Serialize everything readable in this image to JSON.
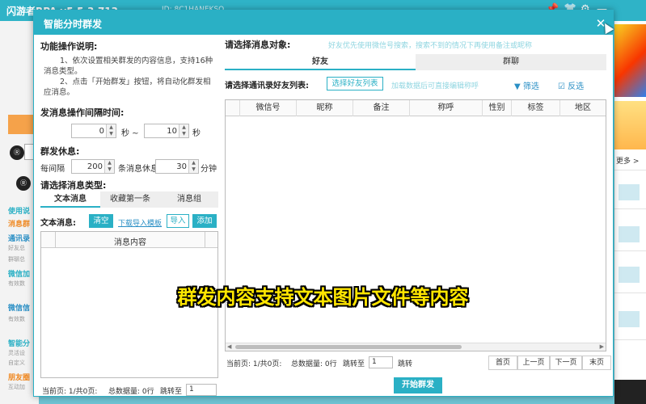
{
  "app": {
    "title": "闪游者RPA  v5.5.3.713",
    "title_extra": "ID: 8C1HANEKSO",
    "sidebar": [
      {
        "label": "使用说",
        "color": "#2ab0c5"
      },
      {
        "label": "消息群",
        "color": "#f08a24"
      },
      {
        "label": "通讯录",
        "color": "#2a8fc5"
      },
      {
        "label": "好友总",
        "color": "#999999",
        "sub": true
      },
      {
        "label": "群聊总",
        "color": "#999999",
        "sub": true
      },
      {
        "label": "微信加",
        "color": "#2ab0c5"
      },
      {
        "label": "有效数",
        "color": "#999999",
        "sub": true
      },
      {
        "label": "微信信",
        "color": "#2a8fc5"
      },
      {
        "label": "有效数",
        "color": "#999999",
        "sub": true
      },
      {
        "label": "智能分",
        "color": "#2ab0c5"
      },
      {
        "label": "灵活设",
        "color": "#999999",
        "sub": true
      },
      {
        "label": "自定义",
        "color": "#999999",
        "sub": true
      },
      {
        "label": "朋友圈",
        "color": "#f08a24"
      },
      {
        "label": "互动加",
        "color": "#999999",
        "sub": true
      }
    ],
    "circle_icons": [
      "Ⓡ",
      "Ⓡ"
    ],
    "right_more": "更多 >"
  },
  "dialog": {
    "title": "智能分时群发",
    "close": "✕",
    "left": {
      "desc_title": "功能操作说明:",
      "desc_1": "1、依次设置相关群发的内容信息，支持16种消息类型。",
      "desc_2": "2、点击「开始群发」按钮，将自动化群发相应消息。",
      "interval_title": "发消息操作间隔时间:",
      "interval_min": "0",
      "interval_sep": "秒 ~",
      "interval_max": "10",
      "interval_unit": "秒",
      "rest_title": "群发休息:",
      "rest_prefix": "每间隔",
      "rest_count": "200",
      "rest_mid": "条消息休息",
      "rest_minutes": "30",
      "rest_unit": "分钟",
      "type_title": "请选择消息类型:",
      "tabs": [
        "文本消息",
        "收藏第一条",
        "消息组"
      ],
      "text_label": "文本消息:",
      "btn_clear": "清空",
      "link_template": "下载导入模板",
      "btn_import": "导入",
      "btn_add": "添加",
      "table_header": "消息内容",
      "pager": {
        "current": "当前页: 1/共0页:",
        "total": "总数据量: 0行",
        "jump": "跳转至",
        "page": "1"
      }
    },
    "right": {
      "target_title": "请选择消息对象:",
      "target_hint": "好友优先使用微信号搜索，搜索不到的情况下再使用备注或昵称",
      "tabs": [
        "好友",
        "群聊"
      ],
      "select_title": "请选择通讯录好友列表:",
      "btn_select": "选择好友列表",
      "select_hint": "加载数据后可直接编辑称呼",
      "filter": "筛选",
      "invert": "反选",
      "columns": [
        "微信号",
        "昵称",
        "备注",
        "称呼",
        "性别",
        "标签",
        "地区"
      ],
      "pager": {
        "current": "当前页: 1/共0页:",
        "total": "总数据量: 0行",
        "jump": "跳转至",
        "page": "1",
        "btn_jump": "跳转",
        "btn_first": "首页",
        "btn_prev": "上一页",
        "btn_next": "下一页",
        "btn_last": "末页"
      }
    },
    "start": "开始群发"
  },
  "caption": "群发内容支持文本图片文件等内容",
  "colors": {
    "accent": "#2ab0c5",
    "caption": "#ffe600"
  }
}
